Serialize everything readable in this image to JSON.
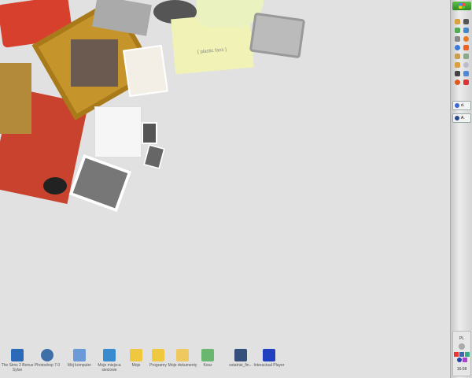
{
  "desktop_icons": [
    {
      "label": "The Sims 2 Bonus Sylse",
      "color": "#2a6ab8"
    },
    {
      "label": "Photoshop 7.0",
      "color": "#3f6fa8"
    },
    {
      "label": "Mój komputer",
      "color": "#6a9ad8"
    },
    {
      "label": "Moje miejsca sieciowe",
      "color": "#3a8ad0"
    },
    {
      "label": "Moje",
      "color": "#f0c840"
    },
    {
      "label": "Programy",
      "color": "#f0c840"
    },
    {
      "label": "Moje dokumenty",
      "color": "#f0c860"
    },
    {
      "label": "Kosz",
      "color": "#6ab870"
    },
    {
      "label": "ostatnie_fin...",
      "color": "#35507a"
    },
    {
      "label": "Interactual Player",
      "color": "#2040c0"
    }
  ],
  "taskbar": {
    "start_icon": "windows-flag-icon",
    "buttons": [
      {
        "label": "d."
      },
      {
        "label": "A."
      }
    ],
    "language": "PL",
    "clock": "16:08"
  },
  "wallpaper": {
    "note_text": "{ plastic fans }"
  }
}
